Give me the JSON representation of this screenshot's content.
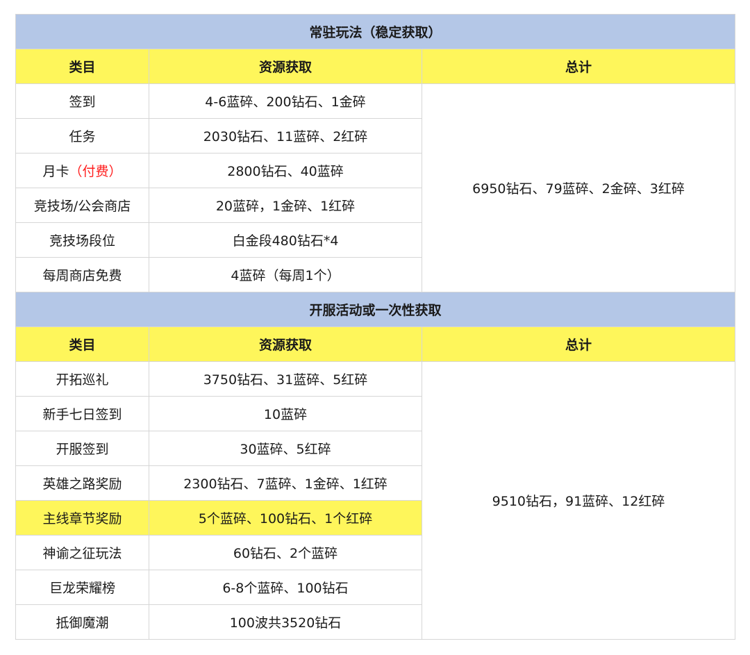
{
  "sections": [
    {
      "title": "常驻玩法（稳定获取）",
      "headers": [
        "类目",
        "资源获取",
        "总计"
      ],
      "rows": [
        {
          "category": "签到",
          "resource": "4-6蓝碎、200钻石、1金碎"
        },
        {
          "category": "任务",
          "resource": "2030钻石、11蓝碎、2红碎"
        },
        {
          "category": "月卡",
          "category_note": "（付费）",
          "resource": "2800钻石、40蓝碎"
        },
        {
          "category": "竞技场/公会商店",
          "resource": "20蓝碎，1金碎、1红碎"
        },
        {
          "category": "竞技场段位",
          "resource": "白金段480钻石*4"
        },
        {
          "category": "每周商店免费",
          "resource": "4蓝碎（每周1个）"
        }
      ],
      "total": "6950钻石、79蓝碎、2金碎、3红碎"
    },
    {
      "title": "开服活动或一次性获取",
      "headers": [
        "类目",
        "资源获取",
        "总计"
      ],
      "rows": [
        {
          "category": "开拓巡礼",
          "resource": "3750钻石、31蓝碎、5红碎"
        },
        {
          "category": "新手七日签到",
          "resource": "10蓝碎"
        },
        {
          "category": "开服签到",
          "resource": "30蓝碎、5红碎"
        },
        {
          "category": "英雄之路奖励",
          "resource": "2300钻石、7蓝碎、1金碎、1红碎"
        },
        {
          "category": "主线章节奖励",
          "resource": "5个蓝碎、100钻石、1个红碎"
        },
        {
          "category": "神谕之征玩法",
          "resource": "60钻石、2个蓝碎"
        },
        {
          "category": "巨龙荣耀榜",
          "resource": "6-8个蓝碎、100钻石"
        },
        {
          "category": "抵御魔潮",
          "resource": "100波共3520钻石"
        }
      ],
      "total": "9510钻石，91蓝碎、12红碎"
    }
  ],
  "colors": {
    "section_bg": "#b4c7e7",
    "header_bg": "#fef65b",
    "highlight_bg": "#fef65b",
    "note_red": "#ff1f1f",
    "border": "#d6d6d6"
  }
}
